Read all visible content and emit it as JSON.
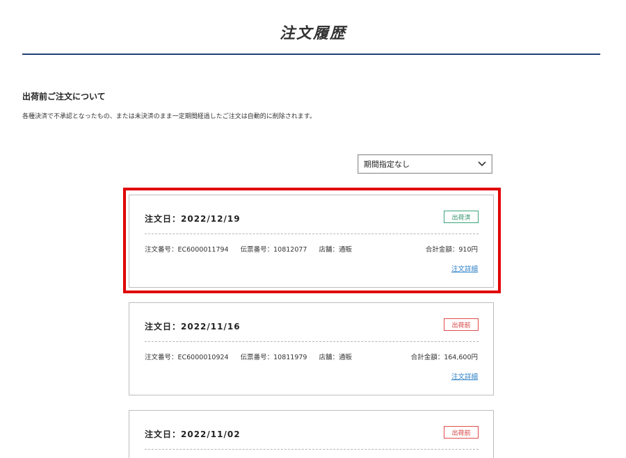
{
  "page": {
    "title": "注文履歴"
  },
  "notice": {
    "heading": "出荷前ご注文について",
    "description": "各種決済で不承認となったもの、または未決済のまま一定期間経過したご注文は自動的に削除されます。"
  },
  "filter": {
    "selected": "期間指定なし"
  },
  "colors": {
    "accent_rule": "#1f3f7a",
    "highlight": "#e00000",
    "shipped": "#2e8f68",
    "pending": "#d33a3a",
    "link": "#2a7fc4"
  },
  "orders": [
    {
      "date": "注文日：2022/12/19",
      "status": "出荷済",
      "status_type": "shipped",
      "order_no": "注文番号：EC6000011794",
      "slip_no": "伝票番号：10812077",
      "store": "店舗：通販",
      "total": "合計金額：910円",
      "detail_link": "注文詳細"
    },
    {
      "date": "注文日：2022/11/16",
      "status": "出荷前",
      "status_type": "pending",
      "order_no": "注文番号：EC6000010924",
      "slip_no": "伝票番号：10811979",
      "store": "店舗：通販",
      "total": "合計金額：164,600円",
      "detail_link": "注文詳細"
    },
    {
      "date": "注文日：2022/11/02",
      "status": "出荷前",
      "status_type": "pending"
    }
  ]
}
